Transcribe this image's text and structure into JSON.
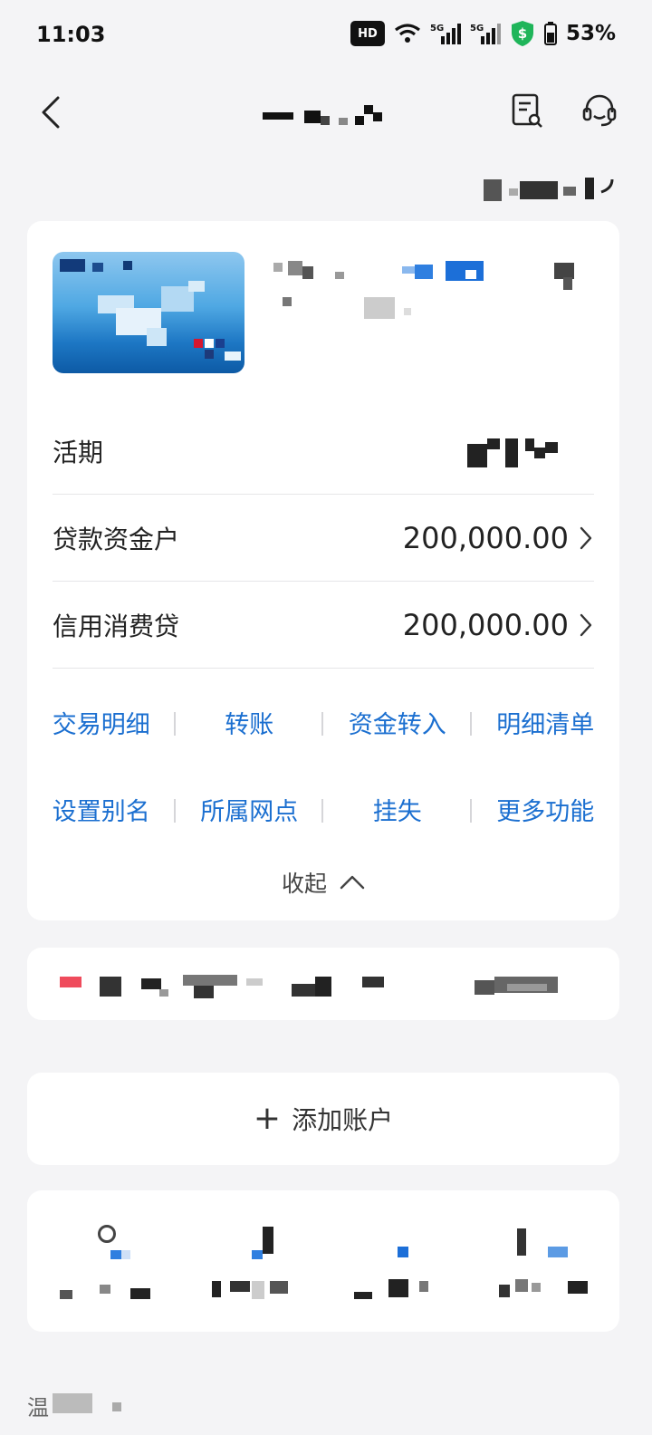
{
  "status_bar": {
    "time": "11:03",
    "hd_badge": "HD",
    "signal_1": "5G",
    "signal_2": "5G",
    "battery": "53%",
    "icons": [
      "wifi-icon",
      "signal-icon",
      "shield-dollar-icon",
      "battery-icon"
    ]
  },
  "header": {
    "back_icon": "chevron-left-icon",
    "actions": [
      "document-search-icon",
      "customer-service-icon"
    ]
  },
  "account": {
    "rows": [
      {
        "label": "活期",
        "value": ""
      },
      {
        "label": "贷款资金户",
        "value": "200,000.00"
      },
      {
        "label": "信用消费贷",
        "value": "200,000.00"
      }
    ],
    "actions_row1": [
      "交易明细",
      "转账",
      "资金转入",
      "明细清单"
    ],
    "actions_row2": [
      "设置别名",
      "所属网点",
      "挂失",
      "更多功能"
    ],
    "collapse_label": "收起"
  },
  "add_account": {
    "label": "添加账户"
  },
  "bottom": {
    "title_char": "温"
  },
  "colors": {
    "accent": "#1b6fd0",
    "background": "#f4f4f6",
    "card": "#ffffff",
    "badge_green": "#1fb55a"
  }
}
